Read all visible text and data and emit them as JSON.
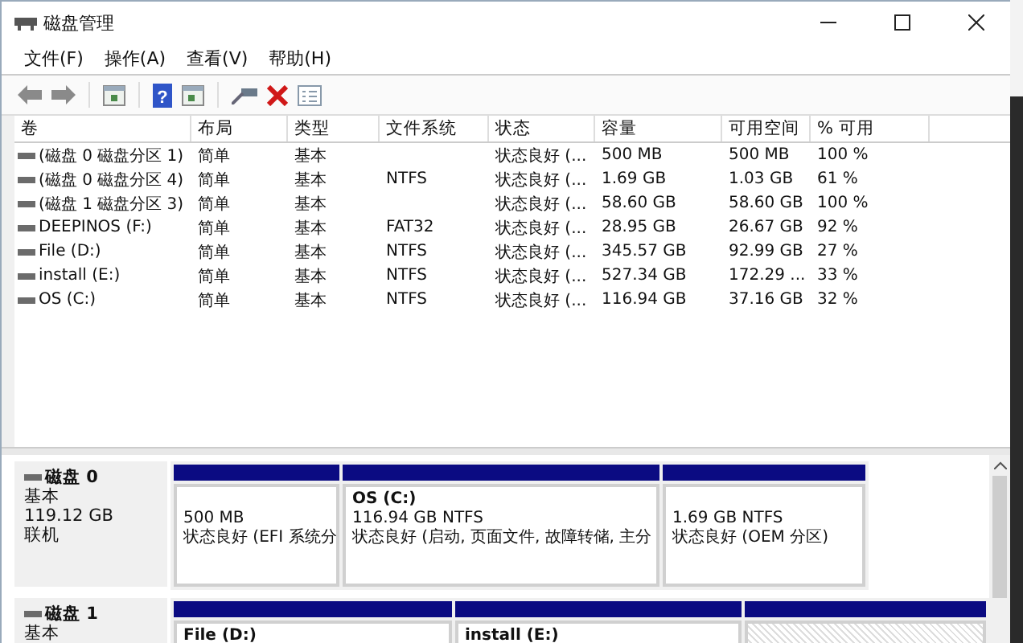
{
  "window": {
    "title": "磁盘管理"
  },
  "toolbar": {
    "help_glyph": "?"
  },
  "menu": [
    "文件(F)",
    "操作(A)",
    "查看(V)",
    "帮助(H)"
  ],
  "table": {
    "columns": [
      "卷",
      "布局",
      "类型",
      "文件系统",
      "状态",
      "容量",
      "可用空间",
      "% 可用"
    ],
    "rows": [
      {
        "cells": [
          "(磁盘 0 磁盘分区 1)",
          "简单",
          "基本",
          "",
          "状态良好 (...",
          "500 MB",
          "500 MB",
          "100 %"
        ]
      },
      {
        "cells": [
          "(磁盘 0 磁盘分区 4)",
          "简单",
          "基本",
          "NTFS",
          "状态良好 (...",
          "1.69 GB",
          "1.03 GB",
          "61 %"
        ]
      },
      {
        "cells": [
          "(磁盘 1 磁盘分区 3)",
          "简单",
          "基本",
          "",
          "状态良好 (...",
          "58.60 GB",
          "58.60 GB",
          "100 %"
        ]
      },
      {
        "cells": [
          "DEEPINOS (F:)",
          "简单",
          "基本",
          "FAT32",
          "状态良好 (...",
          "28.95 GB",
          "26.67 GB",
          "92 %"
        ]
      },
      {
        "cells": [
          "File (D:)",
          "简单",
          "基本",
          "NTFS",
          "状态良好 (...",
          "345.57 GB",
          "92.99 GB",
          "27 %"
        ]
      },
      {
        "cells": [
          "install (E:)",
          "简单",
          "基本",
          "NTFS",
          "状态良好 (...",
          "527.34 GB",
          "172.29 ...",
          "33 %"
        ]
      },
      {
        "cells": [
          "OS (C:)",
          "简单",
          "基本",
          "NTFS",
          "状态良好 (...",
          "116.94 GB",
          "37.16 GB",
          "32 %"
        ]
      }
    ]
  },
  "disks": [
    {
      "name": "磁盘 0",
      "type": "基本",
      "size": "119.12 GB",
      "status": "联机",
      "partitions": [
        {
          "selected": false,
          "lines": [
            "500 MB",
            "状态良好 (EFI 系统分"
          ]
        },
        {
          "selected": false,
          "title": "OS  (C:)",
          "lines": [
            "116.94 GB NTFS",
            "状态良好 (启动, 页面文件, 故障转储, 主分"
          ]
        },
        {
          "selected": false,
          "lines": [
            "1.69 GB NTFS",
            "状态良好 (OEM 分区)"
          ]
        }
      ]
    },
    {
      "name": "磁盘 1",
      "type": "基本",
      "partitions": [
        {
          "selected": false,
          "title": "File  (D:)"
        },
        {
          "selected": false,
          "title": "install  (E:)"
        },
        {
          "selected": true
        }
      ]
    }
  ]
}
